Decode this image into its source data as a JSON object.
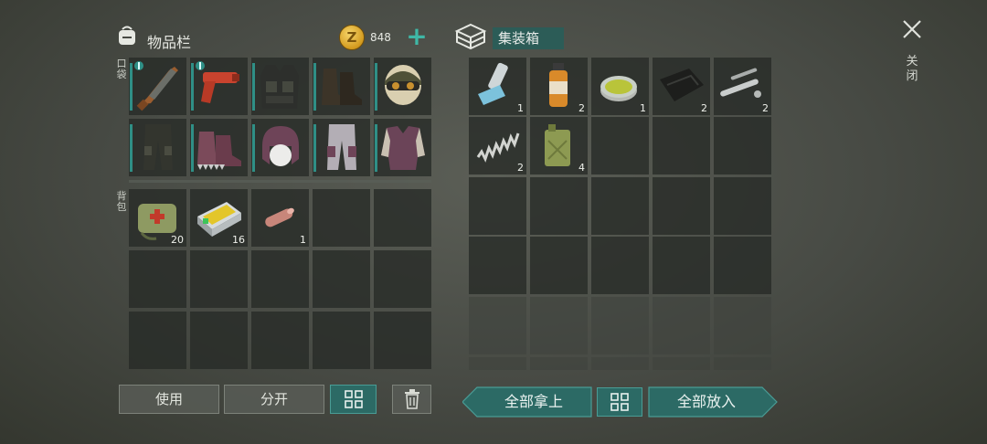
{
  "inventory": {
    "title": "物品栏",
    "coins": "848",
    "pocket_label": "口袋",
    "backpack_label": "背包"
  },
  "chest": {
    "title": "集装箱"
  },
  "close_label": "关闭",
  "buttons": {
    "use": "使用",
    "split": "分开",
    "take_all": "全部拿上",
    "put_all": "全部放入"
  },
  "pocket_items": [
    {
      "name": "shotgun-icon",
      "count": ""
    },
    {
      "name": "flare-gun-icon",
      "count": ""
    },
    {
      "name": "tactical-vest-icon",
      "count": ""
    },
    {
      "name": "boots-icon",
      "count": ""
    },
    {
      "name": "helmet-icon",
      "count": ""
    },
    {
      "name": "pants-icon",
      "count": ""
    },
    {
      "name": "spiked-boots-icon",
      "count": ""
    },
    {
      "name": "trapper-hat-icon",
      "count": ""
    },
    {
      "name": "light-pants-icon",
      "count": ""
    },
    {
      "name": "armored-jacket-icon",
      "count": ""
    }
  ],
  "backpack_items": [
    {
      "name": "first-aid-kit-icon",
      "count": "20"
    },
    {
      "name": "battery-icon",
      "count": "16"
    },
    {
      "name": "finger-icon",
      "count": "1"
    }
  ],
  "chest_items": [
    {
      "name": "inhaler-icon",
      "count": "1"
    },
    {
      "name": "medicine-bottle-icon",
      "count": "2"
    },
    {
      "name": "ointment-tin-icon",
      "count": "1"
    },
    {
      "name": "black-cloth-icon",
      "count": "2"
    },
    {
      "name": "metal-pipe-parts-icon",
      "count": "2"
    },
    {
      "name": "spring-icon",
      "count": "2"
    },
    {
      "name": "jerry-can-icon",
      "count": "4"
    }
  ]
}
